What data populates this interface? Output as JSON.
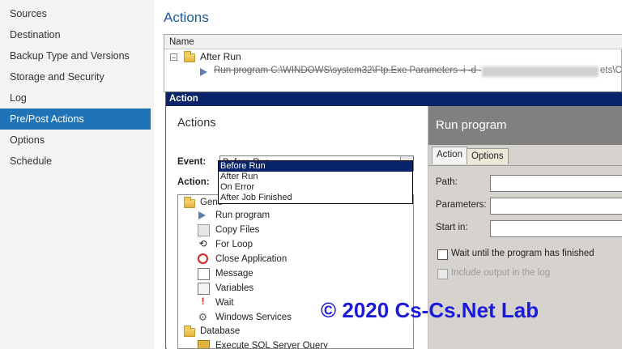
{
  "nav": {
    "items": [
      {
        "label": "Sources"
      },
      {
        "label": "Destination"
      },
      {
        "label": "Backup Type and Versions"
      },
      {
        "label": "Storage and Security"
      },
      {
        "label": "Log"
      },
      {
        "label": "Pre/Post Actions"
      },
      {
        "label": "Options"
      },
      {
        "label": "Schedule"
      }
    ],
    "selected": "Pre/Post Actions"
  },
  "main": {
    "title": "Actions",
    "tree": {
      "column_header": "Name",
      "group_label": "After Run",
      "item_text": "Run program C:\\WINDOWS\\system32\\Ftp.Exe Parameters -i -d -s:\"",
      "item_text_tail": "ets\\Cs"
    }
  },
  "dialog": {
    "title": "Action",
    "left": {
      "heading": "Actions",
      "event_label": "Event:",
      "event_value": "Before Run",
      "action_label": "Action:",
      "dropdown_options": [
        "Before Run",
        "After Run",
        "On Error",
        "After Job Finished"
      ],
      "tree": {
        "general_label": "Gene",
        "items": [
          {
            "label": "Run program",
            "icon": "play-icon"
          },
          {
            "label": "Copy Files",
            "icon": "copy-files-icon"
          },
          {
            "label": "For Loop",
            "icon": "loop-icon"
          },
          {
            "label": "Close Application",
            "icon": "close-application-icon"
          },
          {
            "label": "Message",
            "icon": "message-icon"
          },
          {
            "label": "Variables",
            "icon": "variables-icon"
          },
          {
            "label": "Wait",
            "icon": "wait-icon"
          },
          {
            "label": "Windows Services",
            "icon": "gear-icon"
          }
        ],
        "database_label": "Database",
        "database_items": [
          {
            "label": "Execute SQL Server Query",
            "icon": "database-query-icon"
          }
        ]
      }
    },
    "right": {
      "heading": "Run program",
      "tabs": [
        "Action",
        "Options"
      ],
      "active_tab": "Action",
      "fields": [
        {
          "label": "Path:",
          "value": ""
        },
        {
          "label": "Parameters:",
          "value": ""
        },
        {
          "label": "Start in:",
          "value": ""
        }
      ],
      "checkboxes": [
        {
          "label": "Wait until the program has finished",
          "checked": false,
          "enabled": true
        },
        {
          "label": "Include output in the log",
          "checked": false,
          "enabled": false
        }
      ]
    }
  },
  "watermark": "© 2020 Cs-Cs.Net Lab",
  "colors": {
    "accent": "#1f73b7",
    "dialog_title_bg": "#0a246a",
    "watermark": "#1a1ad9"
  }
}
